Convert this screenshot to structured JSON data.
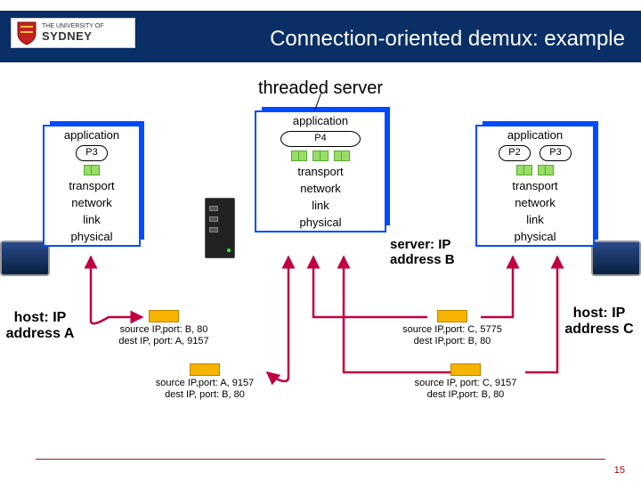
{
  "university": {
    "top": "THE UNIVERSITY OF",
    "name": "SYDNEY"
  },
  "title": "Connection-oriented demux: example",
  "subtitle": "threaded server",
  "layers": {
    "application": "application",
    "transport": "transport",
    "network": "network",
    "link": "link",
    "physical": "physical"
  },
  "procs": {
    "P2": "P2",
    "P3": "P3",
    "P4": "P4"
  },
  "hosts": {
    "A": "host: IP address A",
    "B": "server: IP address B",
    "C": "host: IP address C"
  },
  "packets": {
    "AtoB_resp": {
      "l1": "source IP,port: B, 80",
      "l2": "dest IP, port: A, 9157"
    },
    "AtoB_req": {
      "l1": "source IP,port: A, 9157",
      "l2": "dest IP, port: B, 80"
    },
    "CtoB_1": {
      "l1": "source IP,port: C, 5775",
      "l2": "dest IP,port: B, 80"
    },
    "CtoB_2": {
      "l1": "source IP, port: C, 9157",
      "l2": "dest IP,port: B, 80"
    }
  },
  "page": "15"
}
